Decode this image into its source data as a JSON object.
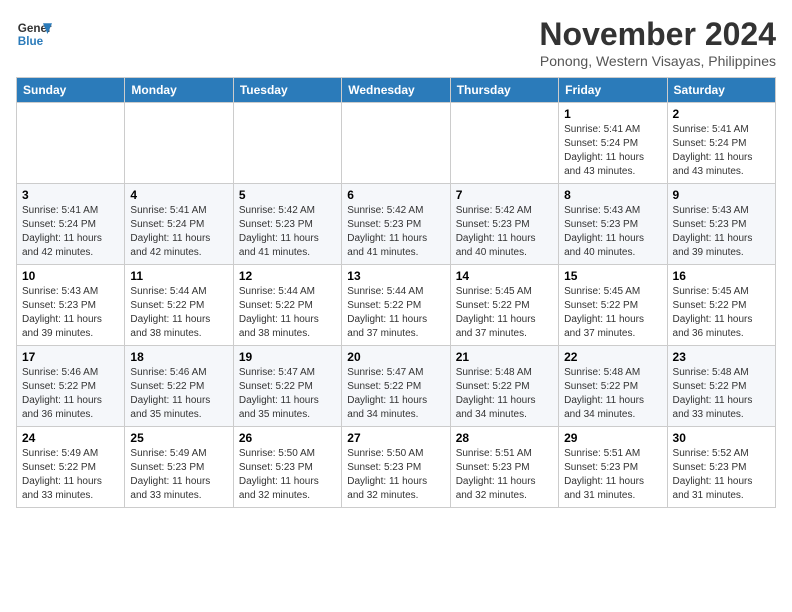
{
  "header": {
    "logo_line1": "General",
    "logo_line2": "Blue",
    "month_title": "November 2024",
    "subtitle": "Ponong, Western Visayas, Philippines"
  },
  "weekdays": [
    "Sunday",
    "Monday",
    "Tuesday",
    "Wednesday",
    "Thursday",
    "Friday",
    "Saturday"
  ],
  "weeks": [
    [
      {
        "day": "",
        "info": ""
      },
      {
        "day": "",
        "info": ""
      },
      {
        "day": "",
        "info": ""
      },
      {
        "day": "",
        "info": ""
      },
      {
        "day": "",
        "info": ""
      },
      {
        "day": "1",
        "info": "Sunrise: 5:41 AM\nSunset: 5:24 PM\nDaylight: 11 hours and 43 minutes."
      },
      {
        "day": "2",
        "info": "Sunrise: 5:41 AM\nSunset: 5:24 PM\nDaylight: 11 hours and 43 minutes."
      }
    ],
    [
      {
        "day": "3",
        "info": "Sunrise: 5:41 AM\nSunset: 5:24 PM\nDaylight: 11 hours and 42 minutes."
      },
      {
        "day": "4",
        "info": "Sunrise: 5:41 AM\nSunset: 5:24 PM\nDaylight: 11 hours and 42 minutes."
      },
      {
        "day": "5",
        "info": "Sunrise: 5:42 AM\nSunset: 5:23 PM\nDaylight: 11 hours and 41 minutes."
      },
      {
        "day": "6",
        "info": "Sunrise: 5:42 AM\nSunset: 5:23 PM\nDaylight: 11 hours and 41 minutes."
      },
      {
        "day": "7",
        "info": "Sunrise: 5:42 AM\nSunset: 5:23 PM\nDaylight: 11 hours and 40 minutes."
      },
      {
        "day": "8",
        "info": "Sunrise: 5:43 AM\nSunset: 5:23 PM\nDaylight: 11 hours and 40 minutes."
      },
      {
        "day": "9",
        "info": "Sunrise: 5:43 AM\nSunset: 5:23 PM\nDaylight: 11 hours and 39 minutes."
      }
    ],
    [
      {
        "day": "10",
        "info": "Sunrise: 5:43 AM\nSunset: 5:23 PM\nDaylight: 11 hours and 39 minutes."
      },
      {
        "day": "11",
        "info": "Sunrise: 5:44 AM\nSunset: 5:22 PM\nDaylight: 11 hours and 38 minutes."
      },
      {
        "day": "12",
        "info": "Sunrise: 5:44 AM\nSunset: 5:22 PM\nDaylight: 11 hours and 38 minutes."
      },
      {
        "day": "13",
        "info": "Sunrise: 5:44 AM\nSunset: 5:22 PM\nDaylight: 11 hours and 37 minutes."
      },
      {
        "day": "14",
        "info": "Sunrise: 5:45 AM\nSunset: 5:22 PM\nDaylight: 11 hours and 37 minutes."
      },
      {
        "day": "15",
        "info": "Sunrise: 5:45 AM\nSunset: 5:22 PM\nDaylight: 11 hours and 37 minutes."
      },
      {
        "day": "16",
        "info": "Sunrise: 5:45 AM\nSunset: 5:22 PM\nDaylight: 11 hours and 36 minutes."
      }
    ],
    [
      {
        "day": "17",
        "info": "Sunrise: 5:46 AM\nSunset: 5:22 PM\nDaylight: 11 hours and 36 minutes."
      },
      {
        "day": "18",
        "info": "Sunrise: 5:46 AM\nSunset: 5:22 PM\nDaylight: 11 hours and 35 minutes."
      },
      {
        "day": "19",
        "info": "Sunrise: 5:47 AM\nSunset: 5:22 PM\nDaylight: 11 hours and 35 minutes."
      },
      {
        "day": "20",
        "info": "Sunrise: 5:47 AM\nSunset: 5:22 PM\nDaylight: 11 hours and 34 minutes."
      },
      {
        "day": "21",
        "info": "Sunrise: 5:48 AM\nSunset: 5:22 PM\nDaylight: 11 hours and 34 minutes."
      },
      {
        "day": "22",
        "info": "Sunrise: 5:48 AM\nSunset: 5:22 PM\nDaylight: 11 hours and 34 minutes."
      },
      {
        "day": "23",
        "info": "Sunrise: 5:48 AM\nSunset: 5:22 PM\nDaylight: 11 hours and 33 minutes."
      }
    ],
    [
      {
        "day": "24",
        "info": "Sunrise: 5:49 AM\nSunset: 5:22 PM\nDaylight: 11 hours and 33 minutes."
      },
      {
        "day": "25",
        "info": "Sunrise: 5:49 AM\nSunset: 5:23 PM\nDaylight: 11 hours and 33 minutes."
      },
      {
        "day": "26",
        "info": "Sunrise: 5:50 AM\nSunset: 5:23 PM\nDaylight: 11 hours and 32 minutes."
      },
      {
        "day": "27",
        "info": "Sunrise: 5:50 AM\nSunset: 5:23 PM\nDaylight: 11 hours and 32 minutes."
      },
      {
        "day": "28",
        "info": "Sunrise: 5:51 AM\nSunset: 5:23 PM\nDaylight: 11 hours and 32 minutes."
      },
      {
        "day": "29",
        "info": "Sunrise: 5:51 AM\nSunset: 5:23 PM\nDaylight: 11 hours and 31 minutes."
      },
      {
        "day": "30",
        "info": "Sunrise: 5:52 AM\nSunset: 5:23 PM\nDaylight: 11 hours and 31 minutes."
      }
    ]
  ]
}
